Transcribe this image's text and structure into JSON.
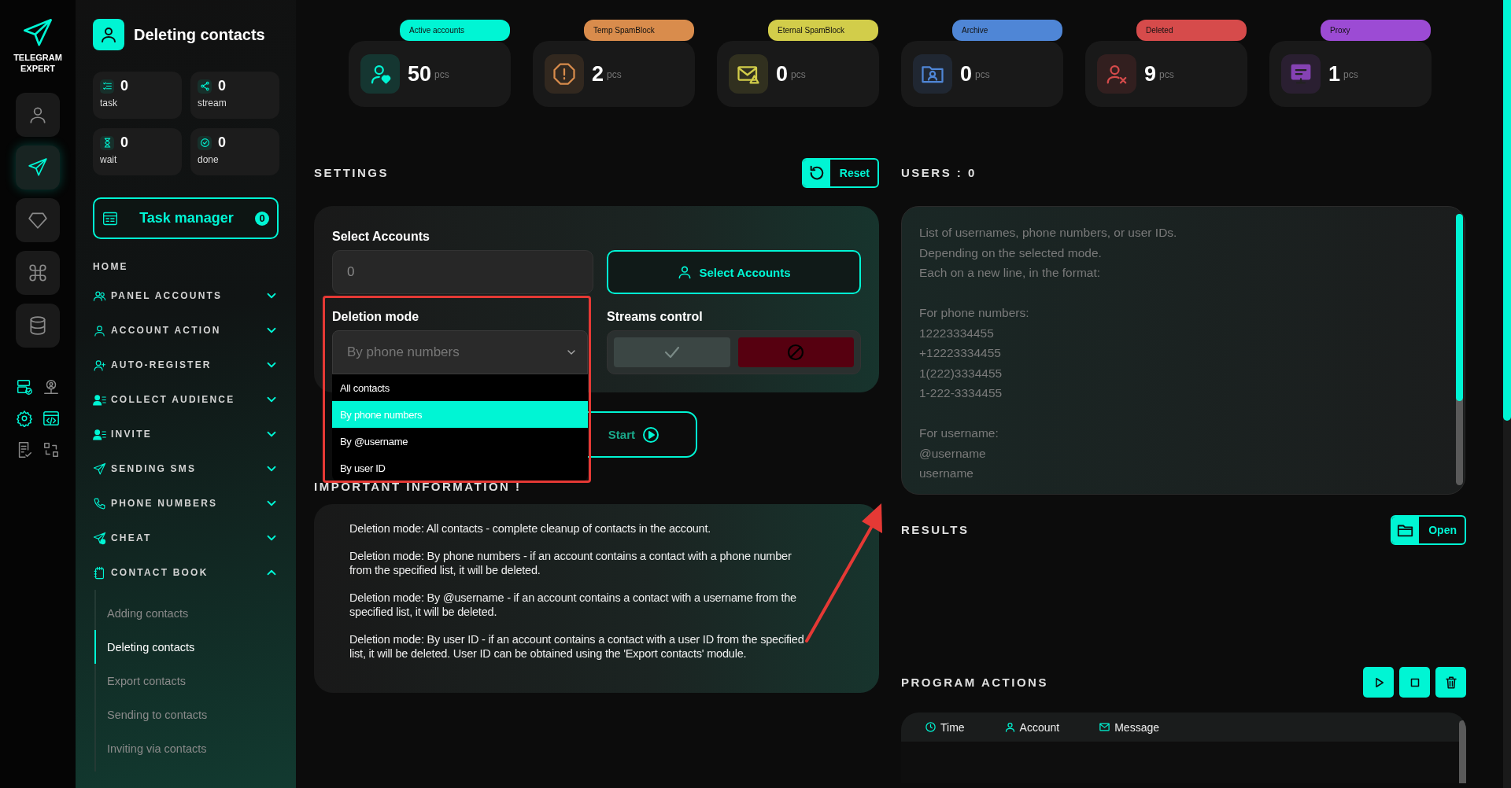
{
  "app": {
    "logo_text": "TELEGRAM EXPERT"
  },
  "rail": {
    "buttons": [
      {
        "selected": false
      },
      {
        "selected": true
      },
      {
        "selected": false
      },
      {
        "selected": false
      },
      {
        "selected": false
      }
    ],
    "tools": [
      {
        "active": true
      },
      {
        "active": false
      },
      {
        "active": true
      },
      {
        "active": true
      },
      {
        "active": false
      },
      {
        "active": false
      }
    ]
  },
  "page": {
    "title": "Deleting contacts"
  },
  "counters": [
    {
      "value": "0",
      "label": "task"
    },
    {
      "value": "0",
      "label": "stream"
    },
    {
      "value": "0",
      "label": "wait"
    },
    {
      "value": "0",
      "label": "done"
    }
  ],
  "task_manager": {
    "label": "Task manager",
    "count": "0"
  },
  "nav": [
    {
      "kind": "link",
      "label": "HOME"
    },
    {
      "kind": "group",
      "label": "PANEL ACCOUNTS",
      "expanded": false
    },
    {
      "kind": "group",
      "label": "ACCOUNT ACTION",
      "expanded": false
    },
    {
      "kind": "group",
      "label": "AUTO-REGISTER",
      "expanded": false
    },
    {
      "kind": "group",
      "label": "COLLECT AUDIENCE",
      "expanded": false
    },
    {
      "kind": "group",
      "label": "INVITE",
      "expanded": false
    },
    {
      "kind": "group",
      "label": "SENDING SMS",
      "expanded": false
    },
    {
      "kind": "group",
      "label": "PHONE NUMBERS",
      "expanded": false
    },
    {
      "kind": "group",
      "label": "CHEAT",
      "expanded": false
    },
    {
      "kind": "group",
      "label": "CONTACT BOOK",
      "expanded": true,
      "children": [
        {
          "label": "Adding contacts",
          "selected": false
        },
        {
          "label": "Deleting contacts",
          "selected": true
        },
        {
          "label": "Export contacts",
          "selected": false
        },
        {
          "label": "Sending to contacts",
          "selected": false
        },
        {
          "label": "Inviting via contacts",
          "selected": false
        }
      ]
    }
  ],
  "stats": [
    {
      "label": "Active accounts",
      "value": "50",
      "unit": "pcs",
      "color": "#00f5d4"
    },
    {
      "label": "Temp SpamBlock",
      "value": "2",
      "unit": "pcs",
      "color": "#d98c4c"
    },
    {
      "label": "Eternal SpamBlock",
      "value": "0",
      "unit": "pcs",
      "color": "#d2cd4a"
    },
    {
      "label": "Archive",
      "value": "0",
      "unit": "pcs",
      "color": "#4f86d6"
    },
    {
      "label": "Deleted",
      "value": "9",
      "unit": "pcs",
      "color": "#d64b4b"
    },
    {
      "label": "Proxy",
      "value": "1",
      "unit": "pcs",
      "color": "#9c4bd4"
    }
  ],
  "settings": {
    "title": "SETTINGS",
    "reset": "Reset",
    "select_accounts": {
      "label": "Select Accounts",
      "value": "0",
      "button": "Select Accounts"
    },
    "deletion_mode": {
      "label": "Deletion mode",
      "value": "By phone numbers",
      "expanded": true,
      "options": [
        {
          "label": "All contacts",
          "selected": false
        },
        {
          "label": "By phone numbers",
          "selected": true
        },
        {
          "label": "By @username",
          "selected": false
        },
        {
          "label": "By user ID",
          "selected": false
        }
      ]
    },
    "streams_control": {
      "label": "Streams control",
      "options": [
        {
          "kind": "enable",
          "selected": false
        },
        {
          "kind": "disable",
          "selected": true
        }
      ]
    },
    "start": "Start"
  },
  "info": {
    "title": "IMPORTANT INFORMATION !",
    "paragraphs": [
      "Deletion mode: All contacts - complete cleanup of contacts in the account.",
      "Deletion mode: By phone numbers - if an account contains a contact with a phone number from the specified list, it will be deleted.",
      "Deletion mode: By @username - if an account contains a contact with a username from the specified list, it will be deleted.",
      "Deletion mode: By user ID - if an account contains a contact with a user ID from the specified list, it will be deleted. User ID can be obtained using the 'Export contacts' module."
    ]
  },
  "users": {
    "title": "USERS : 0",
    "placeholder": "List of usernames, phone numbers, or user IDs.\nDepending on the selected mode.\nEach on a new line, in the format:\n\nFor phone numbers:\n12223334455\n+12223334455\n1(222)3334455\n1-222-3334455\n\nFor username:\n@username\nusername"
  },
  "results": {
    "title": "RESULTS",
    "open": "Open"
  },
  "actions": {
    "title": "PROGRAM ACTIONS",
    "columns": [
      "Time",
      "Account",
      "Message"
    ]
  },
  "annotation_box": true,
  "annotation_arrow": true
}
